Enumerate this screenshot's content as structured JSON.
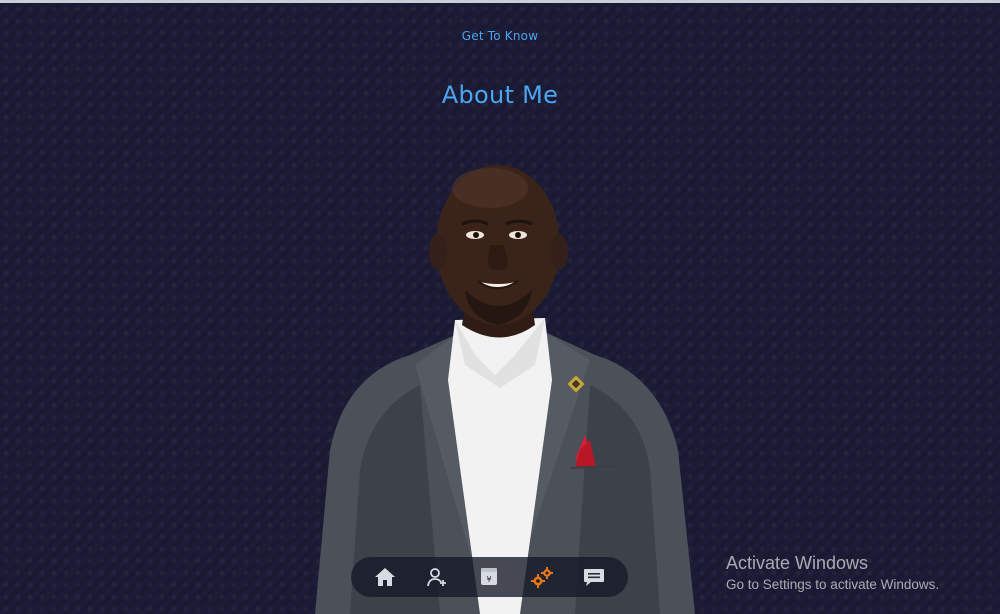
{
  "header": {
    "subtitle": "Get To Know",
    "title": "About Me"
  },
  "portrait": {
    "subject": "profile-photo"
  },
  "nav": {
    "items": [
      {
        "icon": "home-icon",
        "active": false
      },
      {
        "icon": "user-plus-icon",
        "active": false
      },
      {
        "icon": "wallet-icon",
        "active": false
      },
      {
        "icon": "gears-icon",
        "active": true
      },
      {
        "icon": "message-icon",
        "active": false
      }
    ],
    "active_color": "#e8761a",
    "icon_color": "#d8dbe2"
  },
  "watermark": {
    "title": "Activate Windows",
    "subtitle": "Go to Settings to activate Windows."
  }
}
